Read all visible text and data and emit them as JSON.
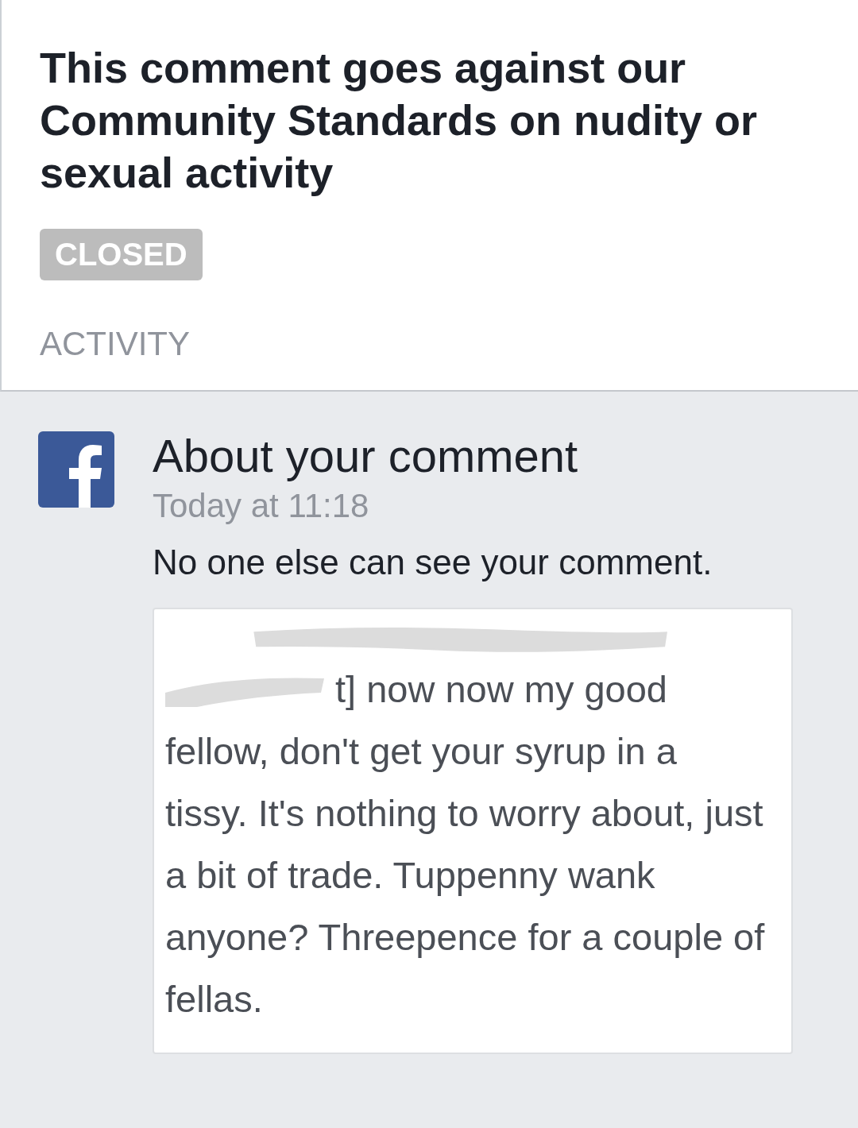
{
  "header": {
    "title": "This comment goes against our Community Standards on nudity or sexual activity",
    "status": "CLOSED",
    "section_label": "ACTIVITY"
  },
  "activity": {
    "title": "About your comment",
    "time": "Today at 11:18",
    "message": "No one else can see your comment.",
    "quote_first_line": "t] now now my good",
    "quote_rest": "fellow, don't get your syrup in a tissy. It's nothing to worry about, just a bit of trade. Tuppenny wank anyone? Threepence for a couple of fellas."
  }
}
